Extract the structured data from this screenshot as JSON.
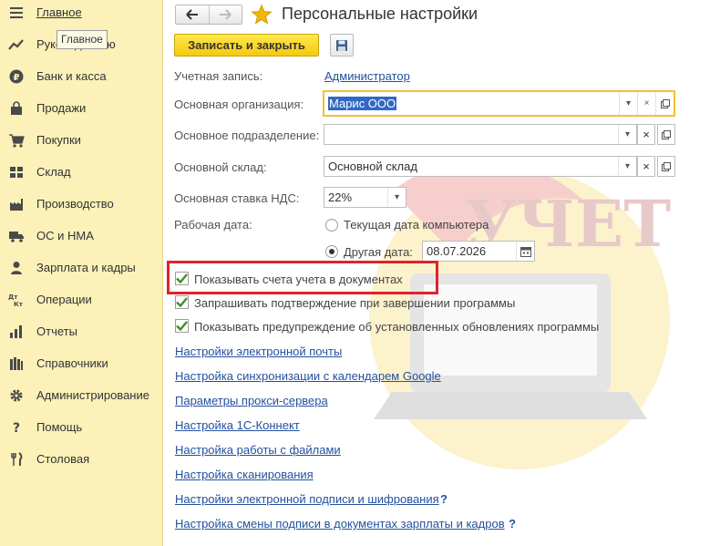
{
  "sidebar": {
    "tooltip": "Главное",
    "items": [
      {
        "label": "Главное",
        "icon": "menu-lines-icon"
      },
      {
        "label": "Руководителю",
        "icon": "trend-chart-icon"
      },
      {
        "label": "Банк и касса",
        "icon": "ruble-coin-icon"
      },
      {
        "label": "Продажи",
        "icon": "shopping-bag-icon"
      },
      {
        "label": "Покупки",
        "icon": "shopping-cart-icon"
      },
      {
        "label": "Склад",
        "icon": "warehouse-grid-icon"
      },
      {
        "label": "Производство",
        "icon": "factory-icon"
      },
      {
        "label": "ОС и НМА",
        "icon": "truck-icon"
      },
      {
        "label": "Зарплата и кадры",
        "icon": "person-icon"
      },
      {
        "label": "Операции",
        "icon": "dt-kt-icon"
      },
      {
        "label": "Отчеты",
        "icon": "report-chart-icon"
      },
      {
        "label": "Справочники",
        "icon": "books-icon"
      },
      {
        "label": "Администрирование",
        "icon": "gear-icon"
      },
      {
        "label": "Помощь",
        "icon": "question-icon"
      },
      {
        "label": "Столовая",
        "icon": "fork-knife-icon"
      }
    ]
  },
  "header": {
    "title": "Персональные настройки",
    "save_close_label": "Записать и закрыть"
  },
  "form": {
    "account_label": "Учетная запись:",
    "account_value": "Администратор",
    "org_label": "Основная организация:",
    "org_value": "Марис ООО",
    "division_label": "Основное подразделение:",
    "division_value": "",
    "warehouse_label": "Основной склад:",
    "warehouse_value": "Основной склад",
    "vat_label": "Основная ставка НДС:",
    "vat_value": "22%",
    "workdate_label": "Рабочая дата:",
    "radio_current": "Текущая дата компьютера",
    "radio_other": "Другая дата:",
    "other_date_value": "08.07.2026"
  },
  "checkboxes": [
    {
      "label": "Показывать счета учета в документах",
      "checked": true
    },
    {
      "label": "Запрашивать подтверждение при завершении программы",
      "checked": true
    },
    {
      "label": "Показывать предупреждение об установленных обновлениях программы",
      "checked": true
    }
  ],
  "links": [
    {
      "label": "Настройки электронной почты"
    },
    {
      "label": "Настройка синхронизации с календарем Google"
    },
    {
      "label": "Параметры прокси-сервера"
    },
    {
      "label": "Настройка 1С-Коннект"
    },
    {
      "label": "Настройка работы с файлами"
    },
    {
      "label": "Настройка сканирования"
    },
    {
      "label": "Настройки электронной подписи и шифрования",
      "help": "?"
    },
    {
      "label": "Настройка смены подписи в документах зарплаты и кадров",
      "help": "?"
    }
  ],
  "colors": {
    "sidebar_bg": "#fbf1b9",
    "primary_button": "#f6c90d",
    "link": "#2450a0",
    "check": "#3b8f2a",
    "highlight": "#e0222b",
    "star": "#f2b705"
  }
}
